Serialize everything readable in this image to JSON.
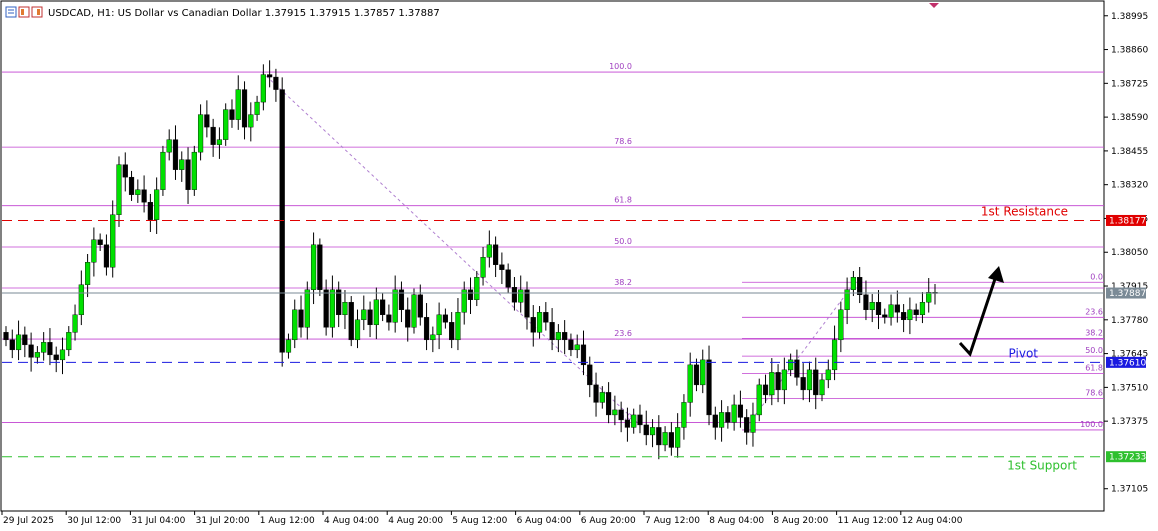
{
  "header": {
    "title": "USDCAD, H1:  US Dollar vs Canadian Dollar  1.37915 1.37915 1.37857 1.37887"
  },
  "colors": {
    "bull": "#00e000",
    "bear": "#000000",
    "fib": "#c040d0",
    "resistance": "#e00000",
    "pivot": "#1a1ae0",
    "support": "#2ec02e",
    "current": "#7a8a96"
  },
  "chart_data": {
    "type": "candlestick",
    "symbol": "USDCAD",
    "timeframe": "H1",
    "ylim": [
      1.3702,
      1.3905
    ],
    "y_ticks": [
      "1.38995",
      "1.38860",
      "1.38725",
      "1.38590",
      "1.38455",
      "1.38320",
      "1.38185",
      "1.38050",
      "1.37915",
      "1.37780",
      "1.37645",
      "1.37510",
      "1.37375",
      "1.37105"
    ],
    "x_ticks": [
      "29 Jul 2025",
      "30 Jul 12:00",
      "31 Jul 04:00",
      "31 Jul 20:00",
      "1 Aug 12:00",
      "4 Aug 04:00",
      "4 Aug 20:00",
      "5 Aug 12:00",
      "6 Aug 04:00",
      "6 Aug 20:00",
      "7 Aug 12:00",
      "8 Aug 04:00",
      "8 Aug 20:00",
      "11 Aug 12:00",
      "12 Aug 04:00"
    ],
    "closes": [
      1.377,
      1.3766,
      1.3772,
      1.3768,
      1.3763,
      1.3765,
      1.3769,
      1.3764,
      1.3762,
      1.3766,
      1.3773,
      1.378,
      1.3792,
      1.3801,
      1.381,
      1.3808,
      1.3799,
      1.382,
      1.384,
      1.3835,
      1.3828,
      1.383,
      1.3825,
      1.3818,
      1.383,
      1.3845,
      1.385,
      1.3838,
      1.3842,
      1.383,
      1.3845,
      1.386,
      1.3855,
      1.3848,
      1.385,
      1.3862,
      1.3858,
      1.387,
      1.3855,
      1.386,
      1.3865,
      1.3876,
      1.3875,
      1.387,
      1.3765,
      1.377,
      1.3782,
      1.3775,
      1.379,
      1.3808,
      1.379,
      1.3775,
      1.379,
      1.378,
      1.3785,
      1.377,
      1.3778,
      1.3782,
      1.3776,
      1.3786,
      1.378,
      1.3777,
      1.379,
      1.3782,
      1.3775,
      1.3788,
      1.3779,
      1.377,
      1.3772,
      1.378,
      1.3777,
      1.377,
      1.3781,
      1.379,
      1.3786,
      1.3795,
      1.3803,
      1.3808,
      1.38,
      1.3798,
      1.3791,
      1.3785,
      1.379,
      1.3779,
      1.3773,
      1.3781,
      1.3777,
      1.377,
      1.3773,
      1.377,
      1.3766,
      1.3768,
      1.376,
      1.3752,
      1.3745,
      1.3749,
      1.374,
      1.3742,
      1.3738,
      1.3735,
      1.374,
      1.3736,
      1.3732,
      1.3735,
      1.3728,
      1.3733,
      1.3727,
      1.3735,
      1.3745,
      1.376,
      1.3752,
      1.3762,
      1.374,
      1.3735,
      1.3741,
      1.3737,
      1.3744,
      1.3739,
      1.3733,
      1.374,
      1.3752,
      1.3748,
      1.3757,
      1.375,
      1.3758,
      1.3762,
      1.3755,
      1.375,
      1.3758,
      1.3748,
      1.3754,
      1.3758,
      1.377,
      1.3782,
      1.379,
      1.3795,
      1.3788,
      1.3782,
      1.3785,
      1.378,
      1.3779,
      1.3784,
      1.3781,
      1.3778,
      1.3782,
      1.378,
      1.3785,
      1.3789,
      1.3789
    ],
    "fib_left": {
      "levels": [
        "100.0",
        "78.6",
        "61.8",
        "50.0",
        "38.2",
        "23.6",
        "0.0"
      ],
      "prices": [
        1.3877,
        1.3847,
        1.38236,
        1.38071,
        1.37907,
        1.37703,
        1.3737
      ]
    },
    "fib_right": {
      "levels": [
        "0.0",
        "23.6",
        "38.2",
        "50.0",
        "61.8",
        "78.6",
        "100.0"
      ],
      "prices": [
        1.3793,
        1.3779,
        1.37705,
        1.37635,
        1.37565,
        1.37466,
        1.3734
      ]
    },
    "current_price": 1.37887,
    "current_label": "1.37887",
    "levels": [
      {
        "name": "1st Resistance",
        "price": 1.38177,
        "label": "1.38177"
      },
      {
        "name": "Pivot",
        "price": 1.3761,
        "label": "1.37610"
      },
      {
        "name": "1st Support",
        "price": 1.37233,
        "label": "1.37233"
      }
    ]
  }
}
